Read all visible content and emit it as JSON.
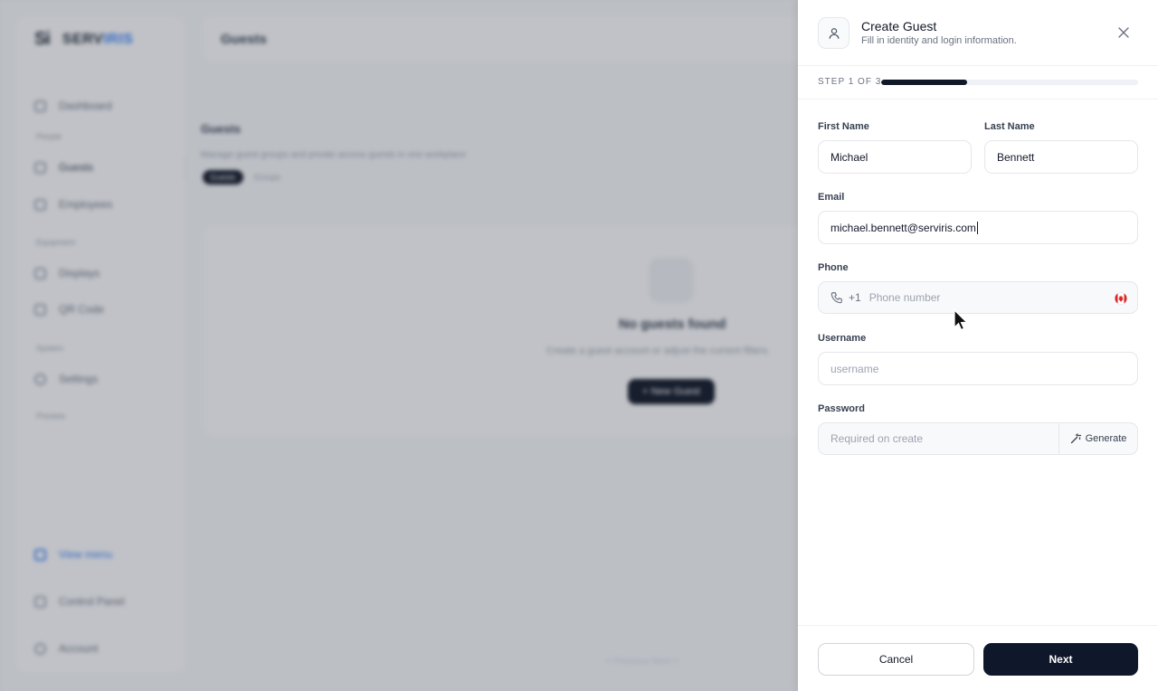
{
  "app": {
    "logo_mark": "Si",
    "logo_text_a": "SERV",
    "logo_text_b": "IRIS",
    "topbar_title": "Guests",
    "sidebar": {
      "dashboard": "Dashboard",
      "section_people": "People",
      "guests": "Guests",
      "employees": "Employees",
      "section_equipment": "Equipment",
      "displays": "Displays",
      "qr_code": "QR Code",
      "section_system": "System",
      "settings": "Settings",
      "preview": "Preview",
      "view_menu": "View menu",
      "control_panel": "Control Panel",
      "account": "Account"
    },
    "main": {
      "title": "Guests",
      "subtitle": "Manage guest groups and private access guests in one workplace",
      "seg_guests": "Guests",
      "seg_groups": "Groups",
      "empty_title": "No guests found",
      "empty_sub": "Create a guest account or adjust the current filters.",
      "empty_button": "+ New Guest",
      "pager": "< Previous    Next >"
    }
  },
  "drawer": {
    "title": "Create Guest",
    "subtitle": "Fill in identity and login information.",
    "step_label": "STEP 1 OF 3",
    "progress": 0.333,
    "fields": {
      "first_name_label": "First Name",
      "first_name_value": "Michael",
      "last_name_label": "Last Name",
      "last_name_value": "Bennett",
      "email_label": "Email",
      "email_value": "michael.bennett@serviris.com",
      "phone_label": "Phone",
      "phone_code": "+1",
      "phone_placeholder": "Phone number",
      "username_label": "Username",
      "username_placeholder": "username",
      "password_label": "Password",
      "password_placeholder": "Required on create",
      "generate_label": "Generate"
    },
    "cancel_label": "Cancel",
    "next_label": "Next"
  },
  "colors": {
    "primary": "#0f172a",
    "brand_blue": "#3b82f6",
    "flag_red": "#dc2626"
  }
}
